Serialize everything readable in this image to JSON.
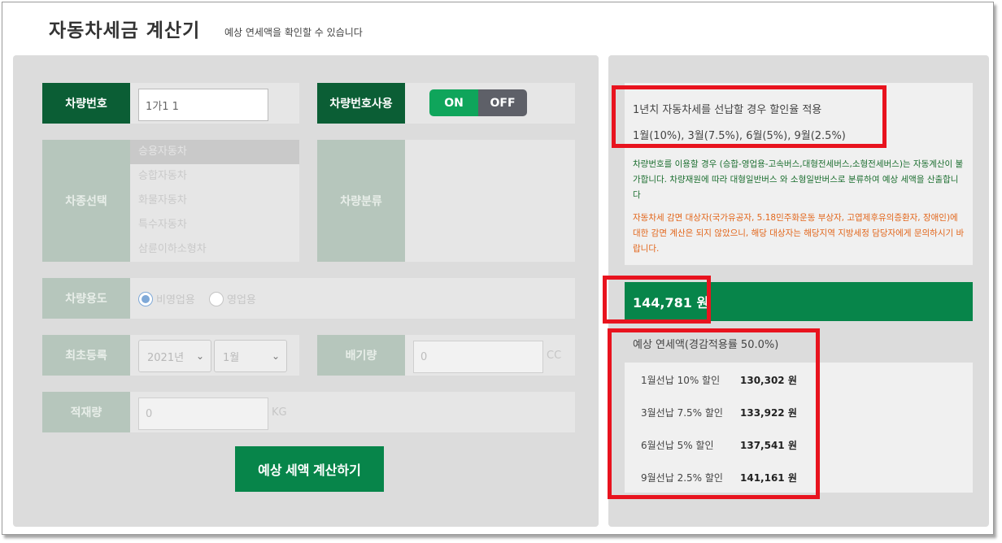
{
  "header": {
    "title": "자동차세금 계산기",
    "subtitle": "예상 연세액을 확인할 수 있습니다"
  },
  "form": {
    "plate": {
      "label": "차량번호",
      "value": "1가1 1"
    },
    "plate_use": {
      "label": "차량번호사용",
      "on_label": "ON",
      "off_label": "OFF",
      "active": "ON"
    },
    "vehicle_type": {
      "label": "차종선택",
      "options": [
        "승용자동차",
        "승합자동차",
        "화물자동차",
        "특수자동차",
        "삼륜이하소형차"
      ],
      "selected": "승용자동차"
    },
    "vehicle_class": {
      "label": "차량분류"
    },
    "usage": {
      "label": "차량용도",
      "options": [
        "비영업용",
        "영업용"
      ],
      "selected": "비영업용"
    },
    "first_registration": {
      "label": "최초등록",
      "year": "2021년",
      "month": "1월"
    },
    "displacement": {
      "label": "배기량",
      "value": "0",
      "unit": "CC"
    },
    "load_capacity": {
      "label": "적재량",
      "value": "0",
      "unit": "KG"
    },
    "calculate_button": "예상 세액 계산하기"
  },
  "info": {
    "line1": "1년치 자동차세를 선납할 경우 할인율 적용",
    "line2": "1월(10%), 3월(7.5%), 6월(5%), 9월(2.5%)",
    "green_note": "차량번호를 이용할 경우 (승합-영업용-고속버스,대형전세버스,소형전세버스)는 자동계산이 불가합니다. 차량재원에 따라 대형일반버스 와 소형일반버스로 분류하여 예상 세액을 산출합니다",
    "orange_note": "자동차세 감면 대상자(국가유공자, 5.18민주화운동 부상자, 고엽제후유의증환자, 장애인)에 대한 감면 계산은 되지 않았으니, 해당 대상자는 해당지역 지방세정 담당자에게 문의하시기 바랍니다."
  },
  "result": {
    "total": "144,781 원",
    "estimate_label": "예상 연세액(경감적용률 50.0%)",
    "rates": [
      {
        "label": "1월선납 10% 할인",
        "value": "130,302 원"
      },
      {
        "label": "3월선납 7.5% 할인",
        "value": "133,922 원"
      },
      {
        "label": "6월선납 5% 할인",
        "value": "137,541 원"
      },
      {
        "label": "9월선납 2.5% 할인",
        "value": "141,161 원"
      }
    ]
  },
  "colors": {
    "brand_green": "#07854a",
    "label_dark": "#0b5e35",
    "toggle_on": "#0fa55b",
    "highlight_red": "#e8131e",
    "note_green": "#1b6e2f",
    "note_orange": "#e2661b"
  },
  "icons": {
    "select_arrow": "chevron-down-icon",
    "radio": "radio-icon"
  }
}
